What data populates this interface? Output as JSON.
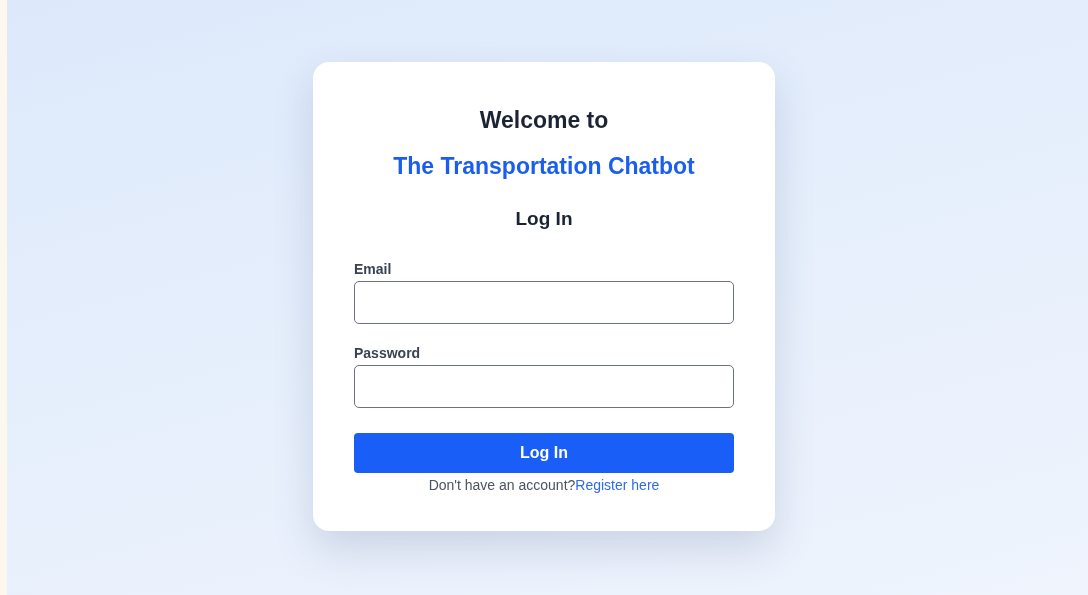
{
  "card": {
    "greeting": "Welcome to",
    "app_name": "The Transportation Chatbot",
    "heading": "Log In",
    "fields": [
      {
        "label": "Email"
      },
      {
        "label": "Password"
      }
    ],
    "submit": "Log In",
    "footer": {
      "text": "Don't have an account?",
      "link": "Register here"
    }
  }
}
